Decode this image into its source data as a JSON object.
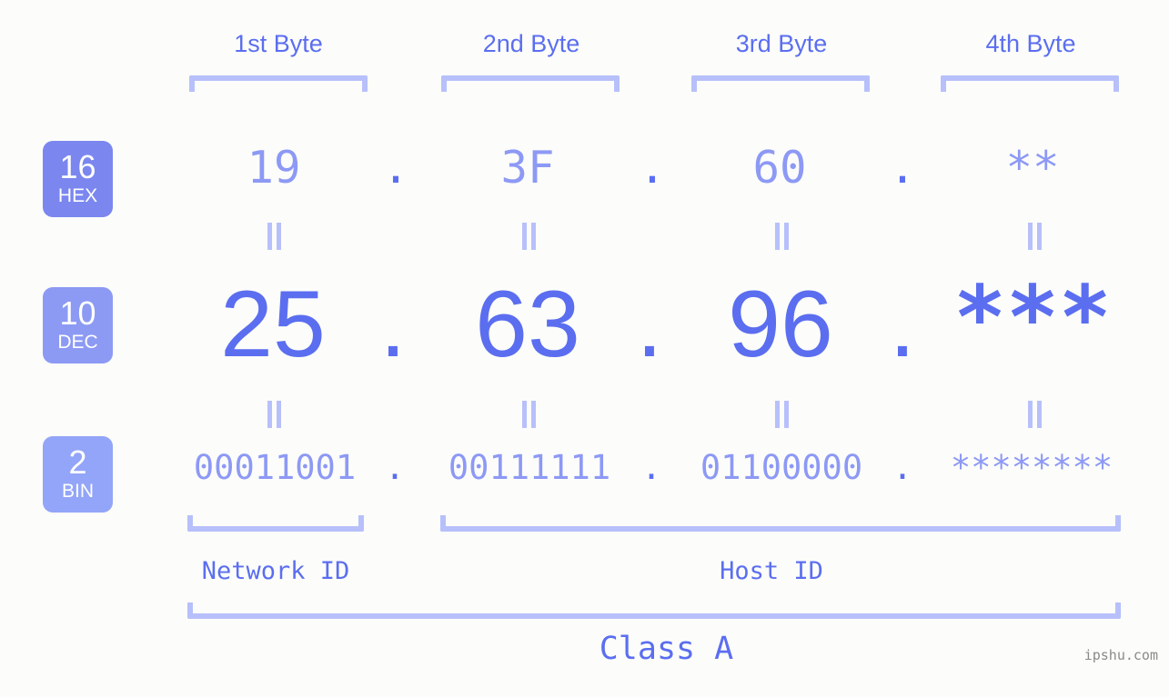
{
  "site": {
    "watermark": "ipshu.com"
  },
  "accent": {
    "strong": "#5b6ef0",
    "mid": "#8d99f5",
    "light": "#b7c0fb",
    "badge_hex": "#7b87ef",
    "badge_dec": "#8c9af4",
    "badge_bin": "#93a5f8",
    "background": "#fcfdfa"
  },
  "byte_headers": [
    {
      "label": "1st Byte"
    },
    {
      "label": "2nd Byte"
    },
    {
      "label": "3rd Byte"
    },
    {
      "label": "4th Byte"
    }
  ],
  "bases": [
    {
      "id": "hex",
      "number": "16",
      "name": "HEX"
    },
    {
      "id": "dec",
      "number": "10",
      "name": "DEC"
    },
    {
      "id": "bin",
      "number": "2",
      "name": "BIN"
    }
  ],
  "rows": {
    "hex": {
      "values": [
        "19",
        "3F",
        "60",
        "**"
      ],
      "separator": "."
    },
    "dec": {
      "values": [
        "25",
        "63",
        "96",
        "***"
      ],
      "separator": "."
    },
    "bin": {
      "values": [
        "00011001",
        "00111111",
        "01100000",
        "********"
      ],
      "separator": "."
    }
  },
  "equality_marks": {
    "glyph": "=",
    "description": "rotated equals sign between base rows",
    "count_per_row": 4
  },
  "segments": {
    "network_id": "Network ID",
    "host_id": "Host ID",
    "class": "Class A"
  }
}
